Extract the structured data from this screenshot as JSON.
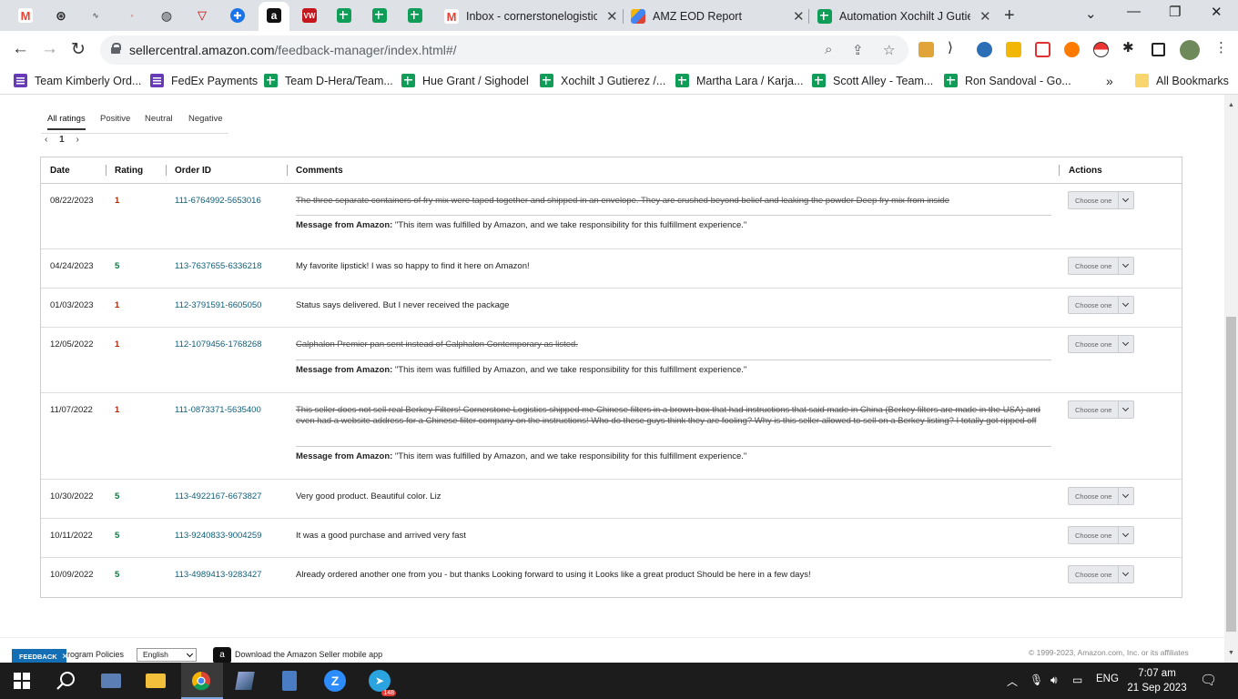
{
  "browser": {
    "tabs": [
      {
        "title": "Inbox - cornerstonelogistic"
      },
      {
        "title": "AMZ EOD Report"
      },
      {
        "title": "Automation Xochilt J Gutie"
      }
    ],
    "address": {
      "host": "sellercentral.amazon.com",
      "path": "/feedback-manager/index.html#/"
    }
  },
  "bookmarks": [
    {
      "label": "Team Kimberly Ord..."
    },
    {
      "label": "FedEx Payments"
    },
    {
      "label": "Team D-Hera/Team..."
    },
    {
      "label": "Hue Grant / Sighodel"
    },
    {
      "label": "Xochilt J Gutierez /..."
    },
    {
      "label": "Martha Lara / Karja..."
    },
    {
      "label": "Scott Alley - Team..."
    },
    {
      "label": "Ron Sandoval - Go..."
    },
    {
      "label": "All Bookmarks"
    }
  ],
  "filters": {
    "all": "All ratings",
    "positive": "Positive",
    "neutral": "Neutral",
    "negative": "Negative"
  },
  "pager": {
    "prev": "‹",
    "page": "1",
    "next": "›"
  },
  "table": {
    "headers": {
      "date": "Date",
      "rating": "Rating",
      "order": "Order ID",
      "comments": "Comments",
      "actions": "Actions"
    },
    "action_label": "Choose one",
    "message_label": "Message from Amazon:",
    "message_text": "\"This item was fulfilled by Amazon, and we take responsibility for this fulfillment experience.\"",
    "rows": [
      {
        "date": "08/22/2023",
        "rating": "1",
        "order": "111-6764992-5653016",
        "comment": "The three separate containers of fry mix were taped together and shipped in an envelope. They are crushed beyond belief and leaking the powder Deep fry mix from inside"
      },
      {
        "date": "04/24/2023",
        "rating": "5",
        "order": "113-7637655-6336218",
        "comment": "My favorite lipstick! I was so happy to find it here on Amazon!"
      },
      {
        "date": "01/03/2023",
        "rating": "1",
        "order": "112-3791591-6605050",
        "comment": "Status says delivered. But I never received the package"
      },
      {
        "date": "12/05/2022",
        "rating": "1",
        "order": "112-1079456-1768268",
        "comment": "Calphalon Premier pan sent instead of Calphalon Contemporary as listed."
      },
      {
        "date": "11/07/2022",
        "rating": "1",
        "order": "111-0873371-5635400",
        "comment": "This seller does not sell real Berkey Filters! Cornerstone Logistics shipped me Chinese filters in a brown box that had instructions that said made in China (Berkey filters are made in the USA) and even had a website address for a Chinese filter company on the instructions! Who do these guys think they are fooling? Why is this seller allowed to sell on a Berkey listing? I totally got ripped off"
      },
      {
        "date": "10/30/2022",
        "rating": "5",
        "order": "113-4922167-6673827",
        "comment": "Very good product. Beautiful color. Liz"
      },
      {
        "date": "10/11/2022",
        "rating": "5",
        "order": "113-9240833-9004259",
        "comment": "It was a good purchase and arrived very fast"
      },
      {
        "date": "10/09/2022",
        "rating": "5",
        "order": "113-4989413-9283427",
        "comment": "Already ordered another one from you - but thanks Looking forward to using it Looks like a great product Should be here in a few days!"
      }
    ]
  },
  "footer": {
    "feedback": "FEEDBACK",
    "policies": "rogram Policies",
    "language": "English",
    "app": "Download the Amazon Seller mobile app",
    "copyright": "© 1999-2023, Amazon.com, Inc. or its affiliates"
  },
  "taskbar": {
    "badge": "148",
    "lang": "ENG",
    "time": "7:07 am",
    "date": "21 Sep 2023"
  }
}
